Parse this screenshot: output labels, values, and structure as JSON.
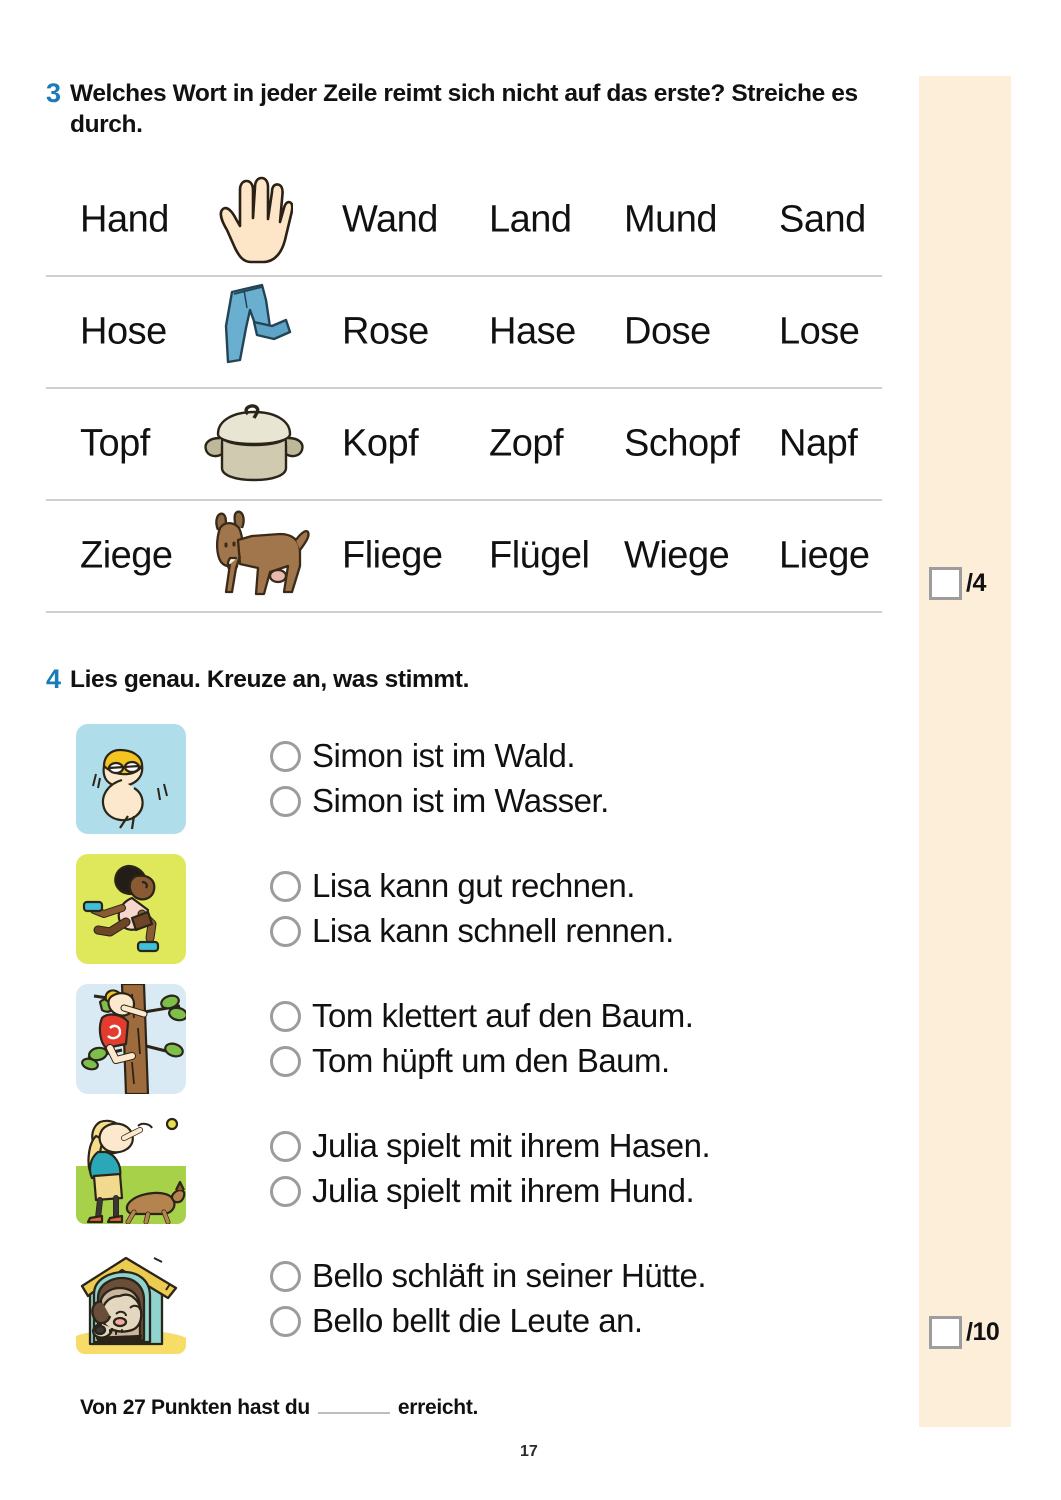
{
  "page": {
    "number": "17",
    "accent_blue": "#1a7bb8",
    "panel_cream": "#fdeed9",
    "rule_grey": "#cfcfcf"
  },
  "exercise3": {
    "number": "3",
    "title": "Welches Wort in jeder Zeile reimt sich nicht auf das erste? Streiche es durch.",
    "score": {
      "box_value": "",
      "label": "/4"
    },
    "rows": [
      {
        "picture": "hand-icon",
        "words": [
          "Hand",
          "Wand",
          "Land",
          "Mund",
          "Sand"
        ]
      },
      {
        "picture": "jeans-icon",
        "words": [
          "Hose",
          "Rose",
          "Hase",
          "Dose",
          "Lose"
        ]
      },
      {
        "picture": "pot-icon",
        "words": [
          "Topf",
          "Kopf",
          "Zopf",
          "Schopf",
          "Napf"
        ]
      },
      {
        "picture": "goat-icon",
        "words": [
          "Ziege",
          "Fliege",
          "Flügel",
          "Wiege",
          "Liege"
        ]
      }
    ]
  },
  "exercise4": {
    "number": "4",
    "title": "Lies genau. Kreuze an, was stimmt.",
    "score": {
      "box_value": "",
      "label": "/10"
    },
    "groups": [
      {
        "picture": "swimmer-icon",
        "options": [
          "Simon ist im Wald.",
          "Simon ist im Wasser."
        ]
      },
      {
        "picture": "runner-icon",
        "options": [
          "Lisa kann gut rechnen.",
          "Lisa kann schnell rennen."
        ]
      },
      {
        "picture": "tree-climber-icon",
        "options": [
          "Tom klettert auf den Baum.",
          "Tom hüpft um den Baum."
        ]
      },
      {
        "picture": "girl-with-dog-icon",
        "options": [
          "Julia spielt mit ihrem Hasen.",
          "Julia spielt mit ihrem Hund."
        ]
      },
      {
        "picture": "doghouse-dog-icon",
        "options": [
          "Bello schläft in seiner Hütte.",
          "Bello bellt die Leute an."
        ]
      }
    ]
  },
  "footer": {
    "prefix": "Von 27 Punkten hast du",
    "blank_value": "",
    "suffix": "erreicht."
  }
}
